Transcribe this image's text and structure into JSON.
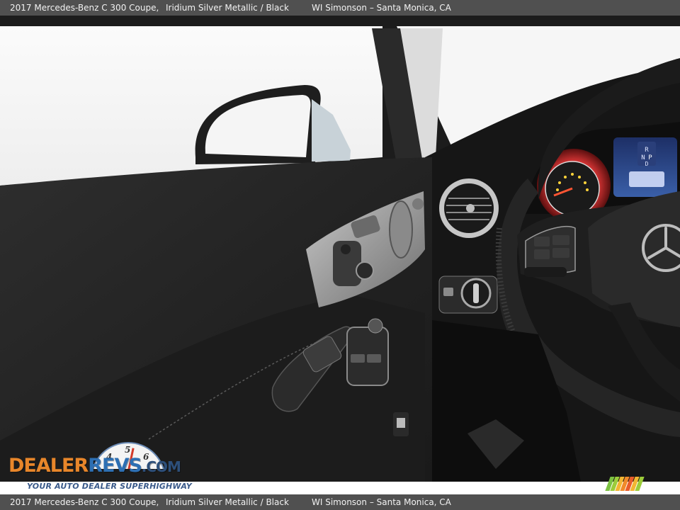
{
  "caption": {
    "vehicle": "2017 Mercedes-Benz C 300 Coupe,",
    "color": "Iridium Silver Metallic / Black",
    "dealer": "WI Simonson – Santa Monica, CA"
  },
  "watermark": {
    "logo_part1": "DEALER",
    "logo_part2": "REVS",
    "logo_part3": ".COM",
    "tagline": "YOUR AUTO DEALER SUPERHIGHWAY",
    "gauge_numbers": [
      "4",
      "5",
      "6"
    ],
    "colors": {
      "orange": "#e8862a",
      "blue": "#2d6fb3",
      "navy": "#2d4f7a"
    }
  },
  "dash": {
    "gear_labels": [
      "R",
      "N",
      "P",
      "D"
    ]
  },
  "stripe_colors": [
    "#7cc242",
    "#9ccc3a",
    "#f2b632",
    "#f08a2a",
    "#e85c2a",
    "#f2b632",
    "#9ccc3a"
  ]
}
